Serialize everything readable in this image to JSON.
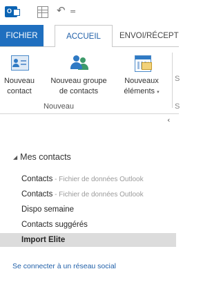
{
  "qat": {
    "app_icon_text": "O",
    "undo_glyph": "↶",
    "more_glyph": "="
  },
  "tabs": [
    {
      "label": "FICHIER"
    },
    {
      "label": "ACCUEIL"
    },
    {
      "label": "ENVOI/RÉCEPT"
    }
  ],
  "ribbon": {
    "buttons": [
      {
        "line1": "Nouveau",
        "line2": "contact"
      },
      {
        "line1": "Nouveau groupe",
        "line2": "de contacts"
      },
      {
        "line1": "Nouveaux",
        "line2": "éléments"
      }
    ],
    "dropdown_glyph": "▾",
    "group_label": "Nouveau",
    "cut_label_1": "S",
    "cut_label_2": "S",
    "collapse_glyph": "‹"
  },
  "folder_pane": {
    "section_toggle": "◢",
    "section_title": "Mes contacts",
    "folders": [
      {
        "name": "Contacts",
        "sub": " - Fichier de données Outlook"
      },
      {
        "name": "Contacts",
        "sub": " - Fichier de données Outlook"
      },
      {
        "name": "Dispo semaine",
        "sub": ""
      },
      {
        "name": "Contacts suggérés",
        "sub": ""
      },
      {
        "name": "Import Elite",
        "sub": ""
      }
    ],
    "social_link": "Se connecter à un réseau social"
  },
  "colors": {
    "file_tab": "#1f6fbf",
    "accent_text": "#1f5fa8",
    "selected_row": "#dcdcdc"
  }
}
